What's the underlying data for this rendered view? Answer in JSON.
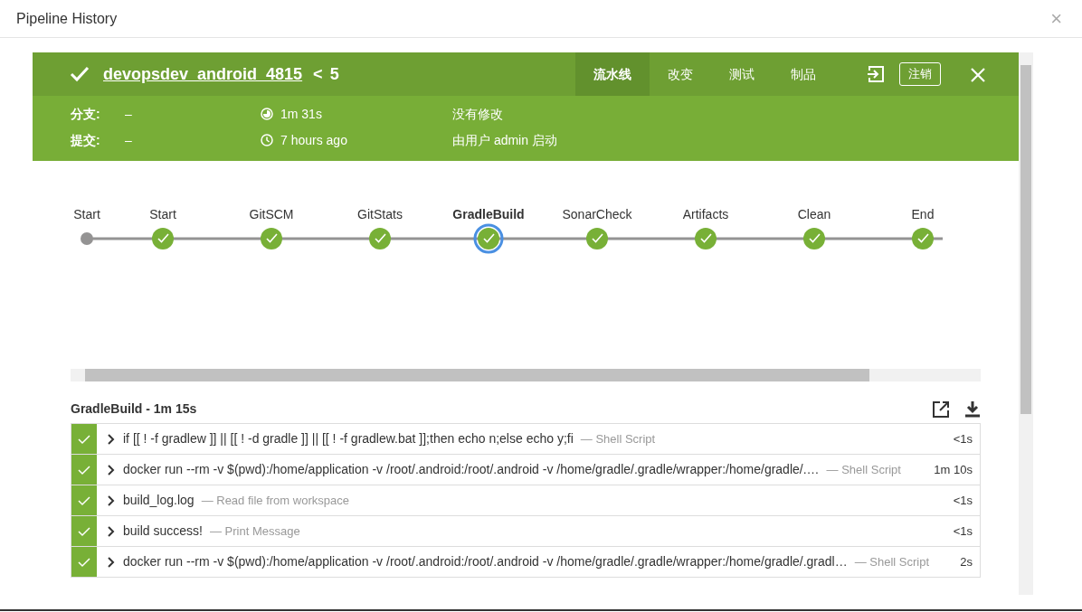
{
  "dialog": {
    "title": "Pipeline History",
    "close": "×"
  },
  "run": {
    "name": "devopsdev_android_4815",
    "separator": "<",
    "number": "5"
  },
  "tabs": [
    {
      "label": "流水线",
      "selected": true
    },
    {
      "label": "改变",
      "selected": false
    },
    {
      "label": "测试",
      "selected": false
    },
    {
      "label": "制品",
      "selected": false
    }
  ],
  "logout": "注销",
  "details": {
    "branch_label": "分支:",
    "branch": "–",
    "commit_label": "提交:",
    "commit": "–",
    "duration": "1m 31s",
    "time": "7 hours ago",
    "changes": "没有修改",
    "cause": "由用户 admin 启动"
  },
  "stages": [
    {
      "label": "Start",
      "kind": "start",
      "selected": false
    },
    {
      "label": "Start",
      "kind": "success",
      "selected": false
    },
    {
      "label": "GitSCM",
      "kind": "success",
      "selected": false
    },
    {
      "label": "GitStats",
      "kind": "success",
      "selected": false
    },
    {
      "label": "GradleBuild",
      "kind": "success",
      "selected": true
    },
    {
      "label": "SonarCheck",
      "kind": "success",
      "selected": false
    },
    {
      "label": "Artifacts",
      "kind": "success",
      "selected": false
    },
    {
      "label": "Clean",
      "kind": "success",
      "selected": false
    },
    {
      "label": "End",
      "kind": "success",
      "selected": false
    }
  ],
  "step_title": "GradleBuild - 1m 15s",
  "steps": [
    {
      "text": "if [[ ! -f gradlew ]] || [[ ! -d gradle ]] || [[ ! -f gradlew.bat ]];then echo n;else echo y;fi",
      "type": "— Shell Script",
      "duration": "<1s"
    },
    {
      "text": "docker run --rm -v $(pwd):/home/application -v /root/.android:/root/.android -v /home/gradle/.gradle/wrapper:/home/gradle/.…",
      "type": "— Shell Script",
      "duration": "1m 10s"
    },
    {
      "text": "build_log.log",
      "type": "— Read file from workspace",
      "duration": "<1s"
    },
    {
      "text": "build success!",
      "type": "— Print Message",
      "duration": "<1s"
    },
    {
      "text": "docker run --rm -v $(pwd):/home/application -v /root/.android:/root/.android -v /home/gradle/.gradle/wrapper:/home/gradle/.gradl…",
      "type": "— Shell Script",
      "duration": "2s"
    }
  ]
}
